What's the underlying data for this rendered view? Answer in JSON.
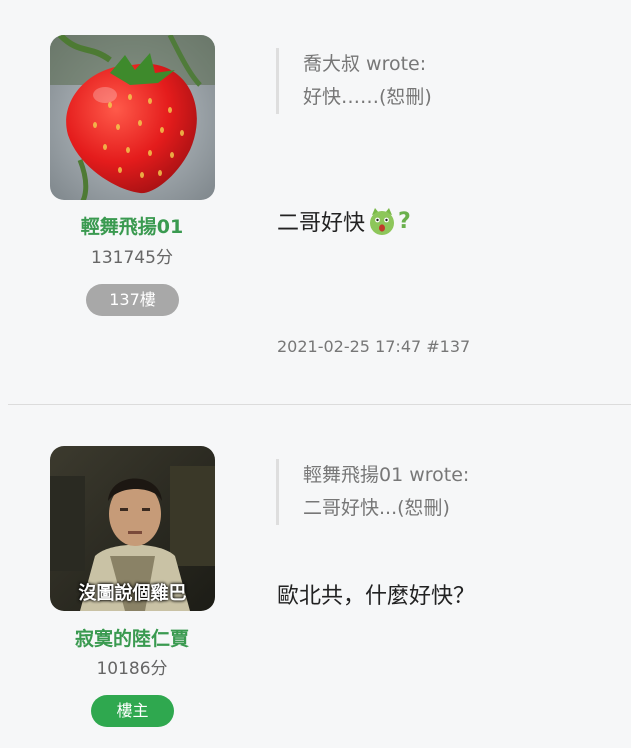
{
  "posts": [
    {
      "username": "輕舞飛揚01",
      "score": "131745分",
      "badge": "137樓",
      "quote_line1": "喬大叔 wrote:",
      "quote_line2": "好快……(恕刪)",
      "content": "二哥好快",
      "content_icons": [
        "surprised-cat-emoji-icon",
        "question-mark-icon"
      ],
      "question_mark": "?",
      "timestamp": "2021-02-25 17:47 #137",
      "avatar": "strawberry-photo"
    },
    {
      "username": "寂寞的陸仁賈",
      "score": "10186分",
      "badge": "樓主",
      "quote_line1": "輕舞飛揚01 wrote:",
      "quote_line2": "二哥好快...(恕刪)",
      "content": "歐北共，什麼好快？",
      "avatar": "movie-still-photo",
      "avatar_caption": "沒圖說個雞巴"
    }
  ],
  "colors": {
    "username": "#3a9a50",
    "badge_floor": "#a8a8a8",
    "badge_owner": "#2fa84f",
    "background": "#f6f7f8"
  }
}
